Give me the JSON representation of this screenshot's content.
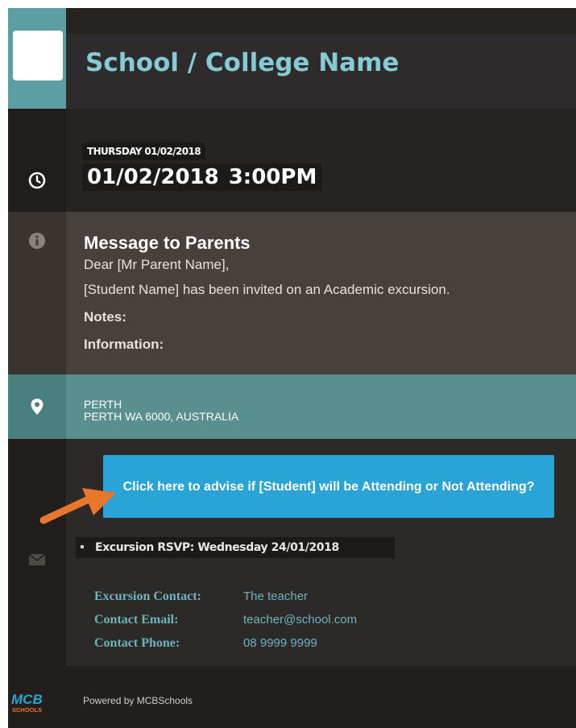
{
  "header": {
    "school_name": "School / College Name"
  },
  "event": {
    "day_label": "THURSDAY 01/02/2018",
    "date": "01/02/2018",
    "time": "3:00PM"
  },
  "message": {
    "title": "Message to Parents",
    "greeting": "Dear  [Mr Parent Name],",
    "body": "[Student Name] has been invited on an Academic excursion.",
    "notes_label": "Notes:",
    "information_label": "Information:"
  },
  "location": {
    "line1": "PERTH",
    "line2": "PERTH WA 6000, AUSTRALIA"
  },
  "rsvp": {
    "button_label": "Click here to advise if [Student] will be Attending or Not Attending?",
    "deadline_text": "Excursion RSVP: Wednesday 24/01/2018"
  },
  "contact": {
    "contact_label": "Excursion Contact:",
    "contact_value": "The teacher",
    "email_label": "Contact Email:",
    "email_value": "teacher@school.com",
    "phone_label": "Contact Phone:",
    "phone_value": "08 9999 9999"
  },
  "footer": {
    "powered_by": "Powered by MCBSchools",
    "logo_text_top": "MCB",
    "logo_text_bottom": "SCHOOLS"
  },
  "icons": {
    "clock": "clock-icon",
    "info": "info-icon",
    "location": "map-pin-icon",
    "mail": "envelope-icon"
  },
  "colors": {
    "accent_teal": "#5b9ea4",
    "title_teal": "#86cbd3",
    "cta_blue": "#2aa3d6",
    "pointer_orange": "#e8762c"
  }
}
